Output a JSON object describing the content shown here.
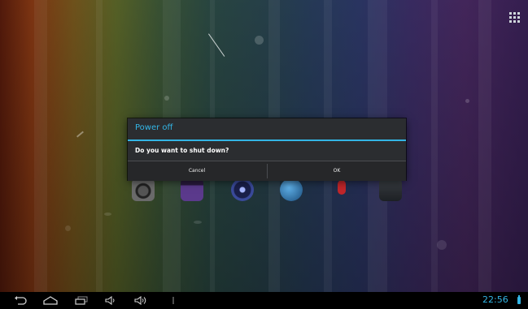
{
  "dialog": {
    "title": "Power off",
    "message": "Do you want to shut down?",
    "cancel_label": "Cancel",
    "ok_label": "OK"
  },
  "status_bar": {
    "time": "22:56"
  },
  "icons": {
    "back": "back-icon",
    "home": "home-icon",
    "recents": "recent-apps-icon",
    "volume_down": "volume-down-icon",
    "volume_up": "volume-up-icon",
    "menu": "menu-icon",
    "all_apps": "all-apps-icon",
    "battery": "battery-icon"
  },
  "colors": {
    "accent": "#33b5e5",
    "dialog_bg": "#2b2d30",
    "system_bar": "#000000"
  }
}
